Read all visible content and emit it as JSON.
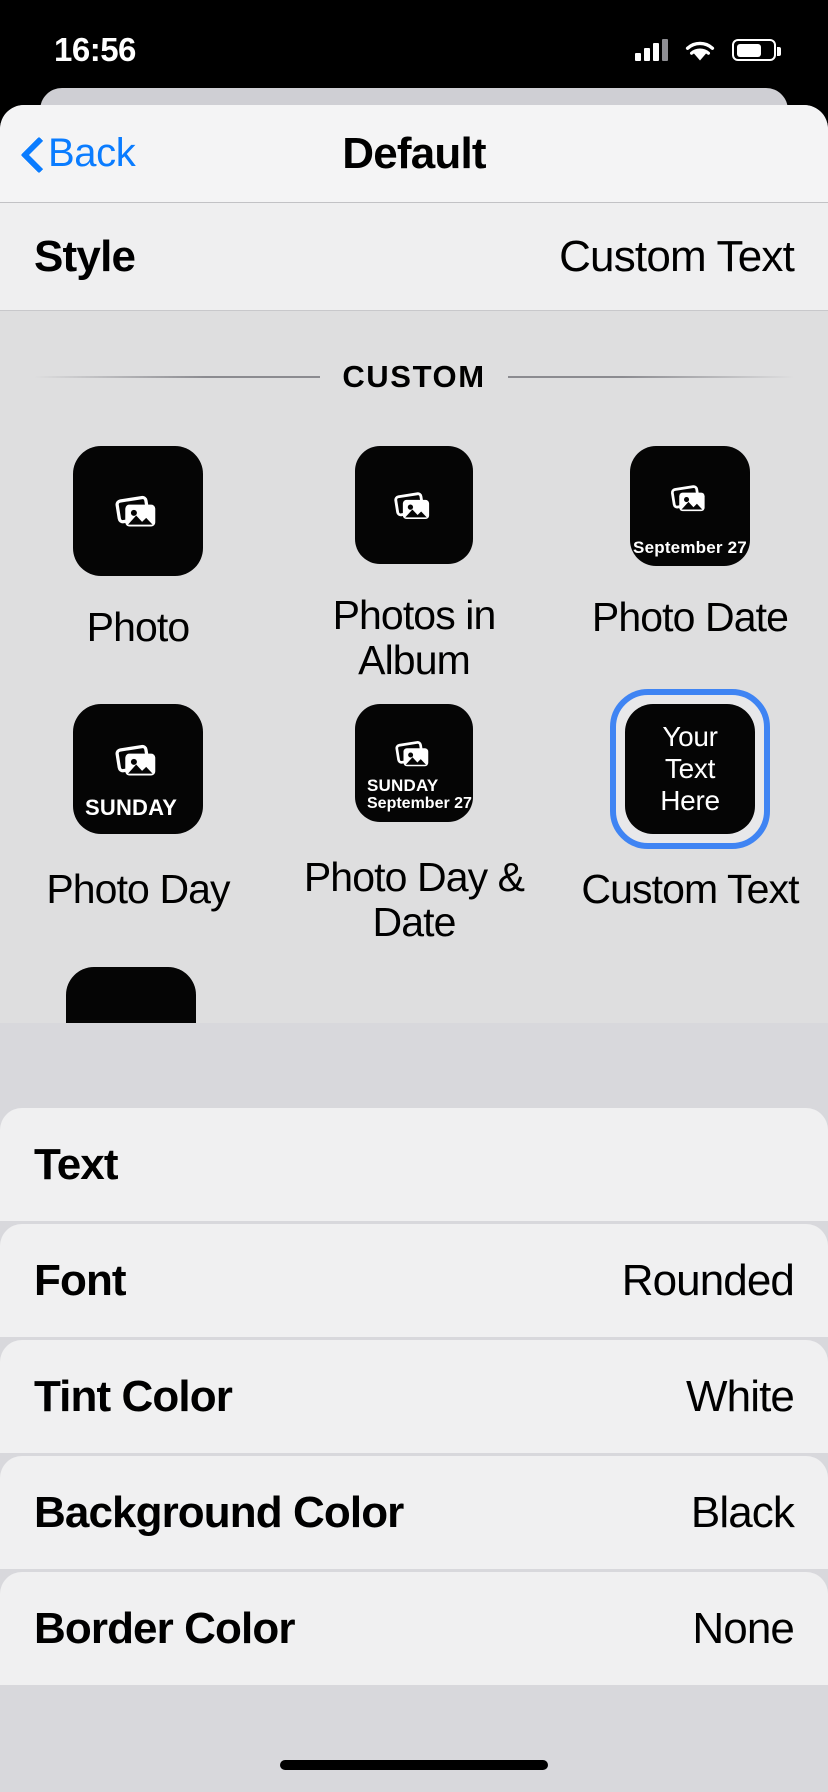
{
  "status_bar": {
    "time": "16:56",
    "cellular_icon": "cellular-signal-icon",
    "wifi_icon": "wifi-icon",
    "battery_icon": "battery-icon"
  },
  "navbar": {
    "back_label": "Back",
    "back_icon": "chevron-left-icon",
    "title": "Default"
  },
  "style_row": {
    "label": "Style",
    "value": "Custom Text"
  },
  "custom_section": {
    "header": "CUSTOM",
    "tiles": [
      {
        "caption": "Photo",
        "icon": "photo-stack-icon",
        "selected": false,
        "overlay_line1": "",
        "overlay_line2": ""
      },
      {
        "caption": "Photos in Album",
        "icon": "photo-stack-icon",
        "selected": false,
        "overlay_line1": "",
        "overlay_line2": ""
      },
      {
        "caption": "Photo Date",
        "icon": "photo-stack-icon",
        "selected": false,
        "overlay_line1": "September 27",
        "overlay_line2": ""
      },
      {
        "caption": "Photo Day",
        "icon": "photo-stack-icon",
        "selected": false,
        "overlay_line1": "SUNDAY",
        "overlay_line2": ""
      },
      {
        "caption": "Photo Day & Date",
        "icon": "photo-stack-icon",
        "selected": false,
        "overlay_line1": "SUNDAY",
        "overlay_line2": "September 27"
      },
      {
        "caption": "Custom Text",
        "icon": "",
        "selected": true,
        "preview_line1": "Your",
        "preview_line2": "Text",
        "preview_line3": "Here"
      }
    ],
    "selection_color": "#3f84f3"
  },
  "settings": {
    "rows": [
      {
        "label": "Text",
        "value": ""
      },
      {
        "label": "Font",
        "value": "Rounded"
      },
      {
        "label": "Tint Color",
        "value": "White"
      },
      {
        "label": "Background Color",
        "value": "Black"
      },
      {
        "label": "Border Color",
        "value": "None"
      }
    ]
  }
}
